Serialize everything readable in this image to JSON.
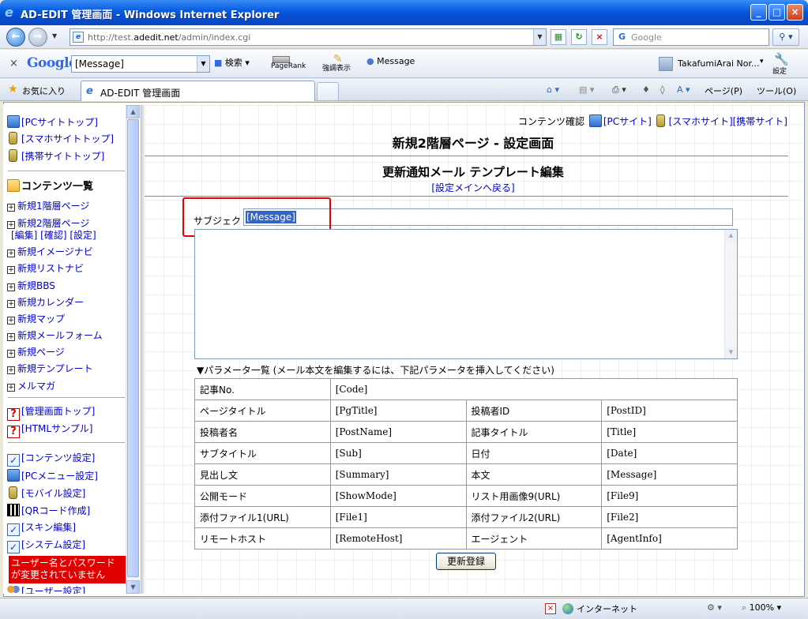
{
  "window": {
    "title": "AD-EDIT 管理画面 - Windows Internet Explorer",
    "ie_icon": "ie-icon"
  },
  "address": {
    "url_prefix": "http://test.",
    "url_domain": "adedit.net",
    "url_path": "/admin/index.cgi",
    "search_placeholder": "Google"
  },
  "google_toolbar": {
    "close": "×",
    "logo": "Google",
    "query": "[Message]",
    "search_label": "検索",
    "pagerank_label": "PageRank",
    "highlight_label": "強調表示",
    "message_label": "Message",
    "user_name": "TakafumiArai Nor...",
    "settings_label": "設定"
  },
  "favorites": {
    "favorites_label": "お気に入り",
    "tab_title": "AD-EDIT 管理画面",
    "page_menu": "ページ(P)",
    "tools_menu": "ツール(O)"
  },
  "sidebar": {
    "pc_top": "[PCサイトトップ]",
    "smartphone_top": "[スマホサイトトップ]",
    "mobile_top": "[携帯サイトトップ]",
    "contents_header": "コンテンツ一覧",
    "items": [
      "新規1階層ページ",
      "新規2階層ページ",
      "新規イメージナビ",
      "新規リストナビ",
      "新規BBS",
      "新規カレンダー",
      "新規マップ",
      "新規メールフォーム",
      "新規ページ",
      "新規テンプレート",
      "メルマガ"
    ],
    "sub_links": "[編集] [確認] [設定]",
    "admin_top": "[管理画面トップ]",
    "html_sample": "[HTMLサンプル]",
    "content_settings": "[コンテンツ設定]",
    "pc_menu_settings": "[PCメニュー設定]",
    "mobile_settings": "[モバイル設定]",
    "qr_code": "[QRコード作成]",
    "skin_edit": "[スキン編集]",
    "system_settings": "[システム設定]",
    "warning": "ユーザー名とパスワードが変更されていません",
    "user_settings": "[ユーザー設定]"
  },
  "main": {
    "content_check": "コンテンツ確認",
    "pc_site": "[PCサイト]",
    "smartphone_mobile": "[スマホサイト][携帯サイト]",
    "page_title": "新規2階層ページ - 設定画面",
    "section_title": "更新通知メール テンプレート編集",
    "back_link": "[設定メインへ戻る]",
    "subject_label": "サブジェクト",
    "subject_value": "[Message]",
    "param_header": "▼パラメータ一覧 (メール本文を編集するには、下記パラメータを挿入してください)",
    "params": [
      [
        [
          "記事No.",
          "[Code]"
        ]
      ],
      [
        [
          "ページタイトル",
          "[PgTitle]"
        ],
        [
          "投稿者ID",
          "[PostID]"
        ]
      ],
      [
        [
          "投稿者名",
          "[PostName]"
        ],
        [
          "記事タイトル",
          "[Title]"
        ]
      ],
      [
        [
          "サブタイトル",
          "[Sub]"
        ],
        [
          "日付",
          "[Date]"
        ]
      ],
      [
        [
          "見出し文",
          "[Summary]"
        ],
        [
          "本文",
          "[Message]"
        ]
      ],
      [
        [
          "公開モード",
          "[ShowMode]"
        ],
        [
          "リスト用画像9(URL)",
          "[File9]"
        ]
      ],
      [
        [
          "添付ファイル1(URL)",
          "[File1]"
        ],
        [
          "添付ファイル2(URL)",
          "[File2]"
        ]
      ],
      [
        [
          "リモートホスト",
          "[RemoteHost]"
        ],
        [
          "エージェント",
          "[AgentInfo]"
        ]
      ]
    ],
    "submit_label": "更新登録"
  },
  "status": {
    "zone": "インターネット",
    "zoom": "100%"
  }
}
